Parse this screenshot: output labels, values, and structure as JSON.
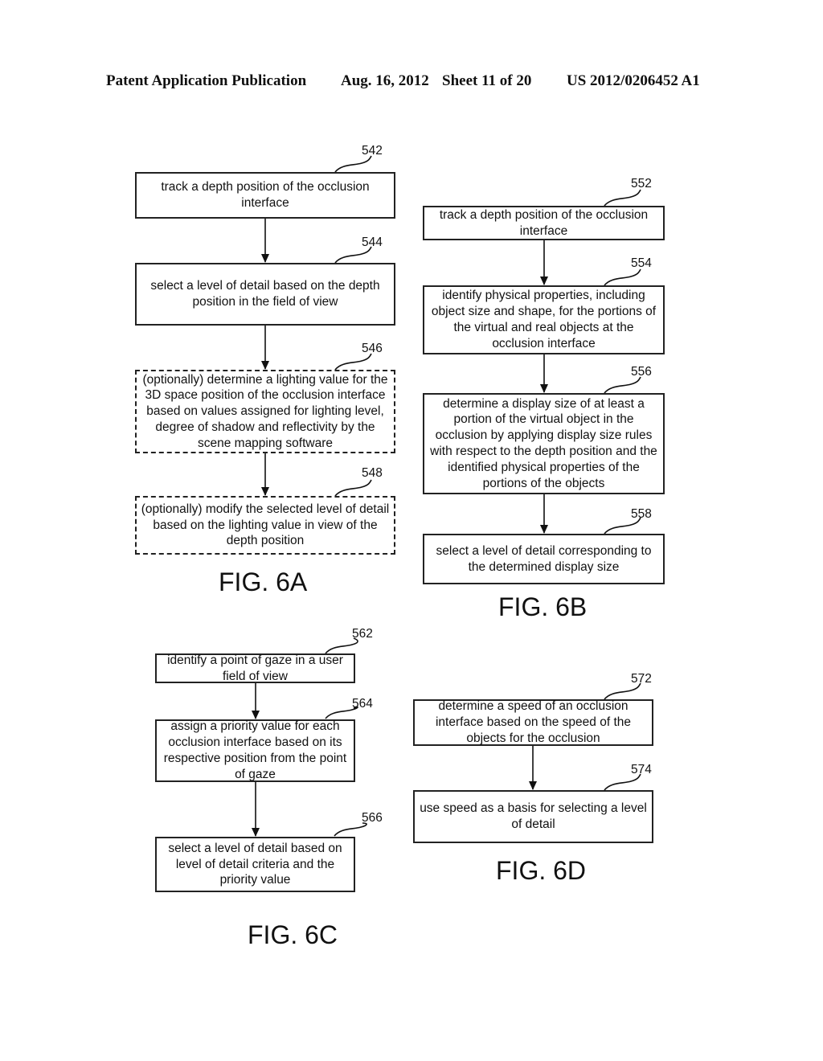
{
  "header": {
    "publication_type": "Patent Application Publication",
    "date": "Aug. 16, 2012",
    "sheet": "Sheet 11 of 20",
    "patent_number": "US 2012/0206452 A1"
  },
  "figures": {
    "fig6a": {
      "label": "FIG. 6A",
      "steps": [
        {
          "ref": "542",
          "text": "track a depth position of the occlusion interface",
          "optional": false
        },
        {
          "ref": "544",
          "text": "select a level of detail based on the depth position in the field of view",
          "optional": false
        },
        {
          "ref": "546",
          "text": "(optionally) determine a lighting value for the 3D space position of the occlusion interface based on values assigned for lighting level, degree of shadow and reflectivity by the scene mapping software",
          "optional": true
        },
        {
          "ref": "548",
          "text": "(optionally) modify the selected level of detail based on the lighting value in view of the depth position",
          "optional": true
        }
      ]
    },
    "fig6b": {
      "label": "FIG. 6B",
      "steps": [
        {
          "ref": "552",
          "text": "track a depth position of the occlusion interface",
          "optional": false
        },
        {
          "ref": "554",
          "text": "identify physical properties, including object size and shape, for the portions of the virtual and real objects at the occlusion interface",
          "optional": false
        },
        {
          "ref": "556",
          "text": "determine a display size of at least a portion of the virtual object in the occlusion by applying display size rules with respect to the depth position and the identified physical properties of the portions of the objects",
          "optional": false
        },
        {
          "ref": "558",
          "text": "select a level of detail corresponding to the determined display size",
          "optional": false
        }
      ]
    },
    "fig6c": {
      "label": "FIG. 6C",
      "steps": [
        {
          "ref": "562",
          "text": "identify a point of gaze in a user field of view",
          "optional": false
        },
        {
          "ref": "564",
          "text": "assign a priority value for each occlusion interface based on its respective position from the point of gaze",
          "optional": false
        },
        {
          "ref": "566",
          "text": "select a level of detail based on level of detail criteria and the priority value",
          "optional": false
        }
      ]
    },
    "fig6d": {
      "label": "FIG. 6D",
      "steps": [
        {
          "ref": "572",
          "text": "determine a speed of an occlusion interface based on the speed of the objects for the occlusion",
          "optional": false
        },
        {
          "ref": "574",
          "text": "use speed as a basis for selecting a level of detail",
          "optional": false
        }
      ]
    }
  }
}
